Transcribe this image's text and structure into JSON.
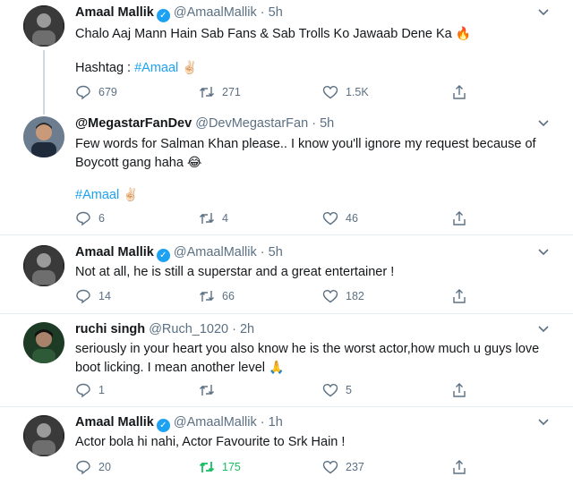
{
  "tweets": [
    {
      "name": "Amaal Mallik",
      "verified": true,
      "handle": "@AmaalMallik",
      "separator": "·",
      "time": "5h",
      "text": "Chalo Aaj Mann Hain Sab Fans & Sab Trolls Ko Jawaab Dene Ka",
      "emoji": "🔥",
      "line2_prefix": "Hashtag : ",
      "hashtag": "#Amaal",
      "hashtag_emoji": "✌🏻",
      "replies": "679",
      "retweets": "271",
      "likes": "1.5K"
    },
    {
      "name": "@MegastarFanDev",
      "verified": false,
      "handle": "@DevMegastarFan",
      "separator": "·",
      "time": "5h",
      "text": "Few words for Salman Khan please.. I know you'll ignore my request because of Boycott gang haha",
      "emoji": "😂",
      "hashtag": "#Amaal",
      "hashtag_emoji": "✌🏻",
      "replies": "6",
      "retweets": "4",
      "likes": "46"
    },
    {
      "name": "Amaal Mallik",
      "verified": true,
      "handle": "@AmaalMallik",
      "separator": "·",
      "time": "5h",
      "text": "Not at all, he is still a superstar and a great entertainer !",
      "replies": "14",
      "retweets": "66",
      "likes": "182"
    },
    {
      "name": "ruchi singh",
      "verified": false,
      "handle": "@Ruch_1020",
      "separator": "·",
      "time": "2h",
      "text": "seriously in your heart  you also know he is the worst actor,how much u guys love boot licking. I mean another level",
      "emoji": "🙏",
      "replies": "1",
      "retweets": "",
      "likes": "5"
    },
    {
      "name": "Amaal Mallik",
      "verified": true,
      "handle": "@AmaalMallik",
      "separator": "·",
      "time": "1h",
      "text": "Actor bola hi nahi, Actor Favourite to Srk Hain !",
      "replies": "20",
      "retweets": "175",
      "likes": "237"
    }
  ],
  "icons": {
    "verified": "verified-badge-icon",
    "reply": "reply-icon",
    "retweet": "retweet-icon",
    "like": "heart-icon",
    "share": "share-icon",
    "more": "chevron-down-icon"
  },
  "colors": {
    "link": "#1da1f2",
    "muted": "#5b7083",
    "retweet_active": "#17bf63"
  }
}
